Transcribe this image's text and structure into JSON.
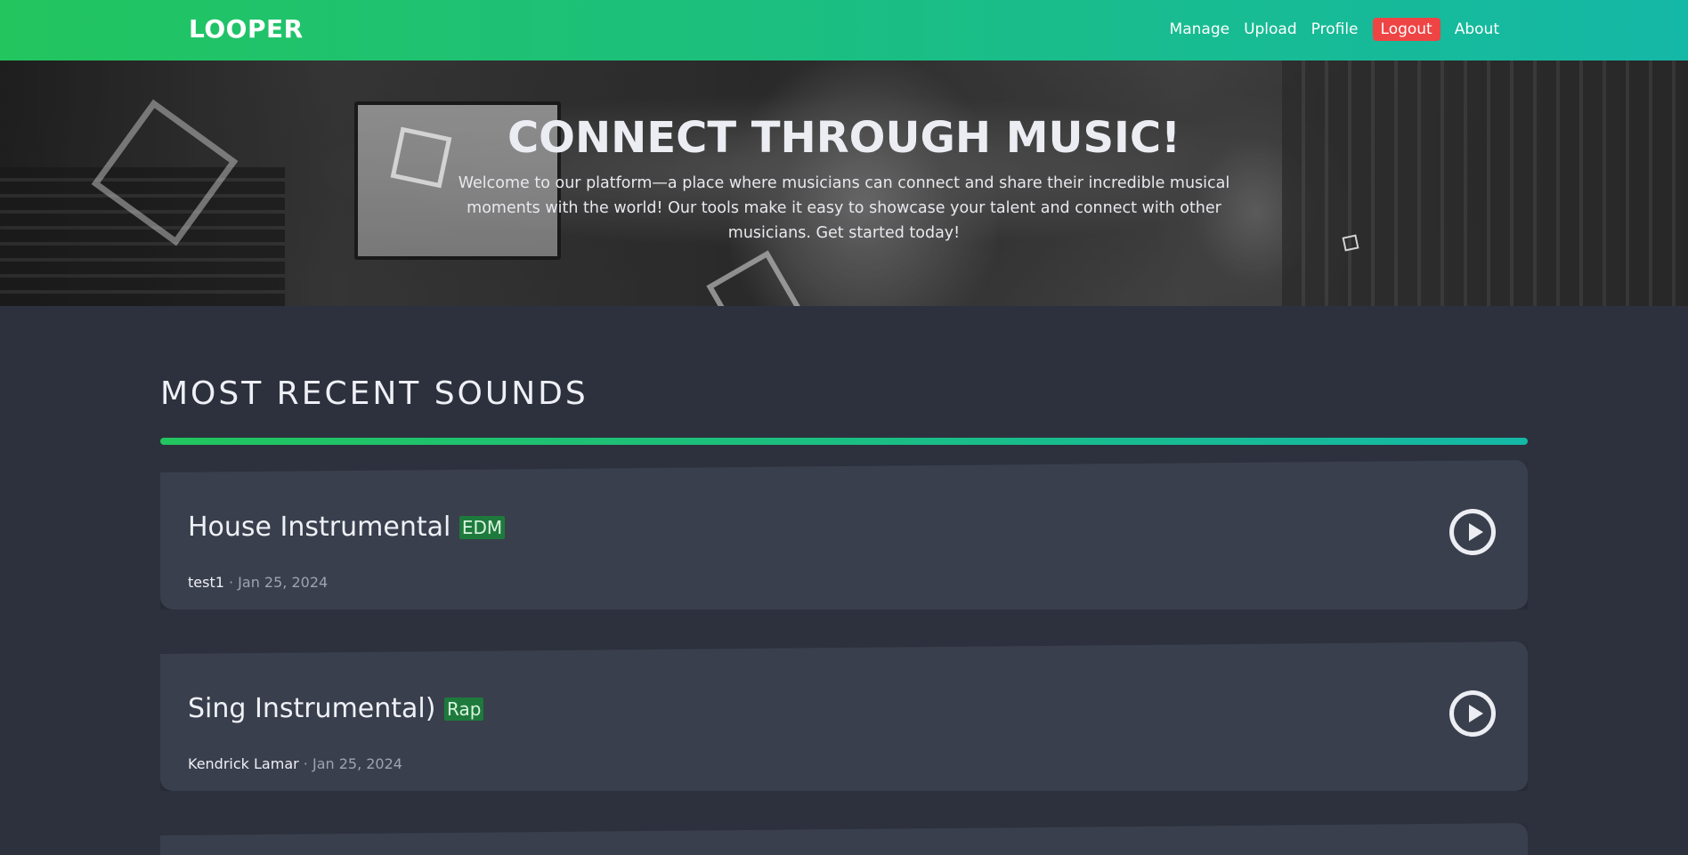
{
  "navbar": {
    "brand": "LOOPER",
    "links": [
      "Manage",
      "Upload",
      "Profile",
      "Logout",
      "About"
    ]
  },
  "hero": {
    "title": "CONNECT THROUGH MUSIC!",
    "text": "Welcome to our platform—a place where musicians can connect and share their incredible musical moments with the world! Our tools make it easy to showcase your talent and connect with other musicians. Get started today!"
  },
  "section": {
    "title": "MOST RECENT SOUNDS"
  },
  "sounds": [
    {
      "title": "House Instrumental",
      "genre": "EDM",
      "author": "test1",
      "date": "Jan 25, 2024"
    },
    {
      "title": "Sing Instrumental)",
      "genre": "Rap",
      "author": "Kendrick Lamar",
      "date": "Jan 25, 2024"
    }
  ],
  "colors": {
    "accent_gradient_start": "#22c55e",
    "accent_gradient_end": "#14b8a6",
    "logout": "#ef4444",
    "background": "#2d313d",
    "card": "#3a3f4d",
    "badge": "#1e7a3c"
  },
  "icons": {
    "play": "play-circle-icon"
  }
}
